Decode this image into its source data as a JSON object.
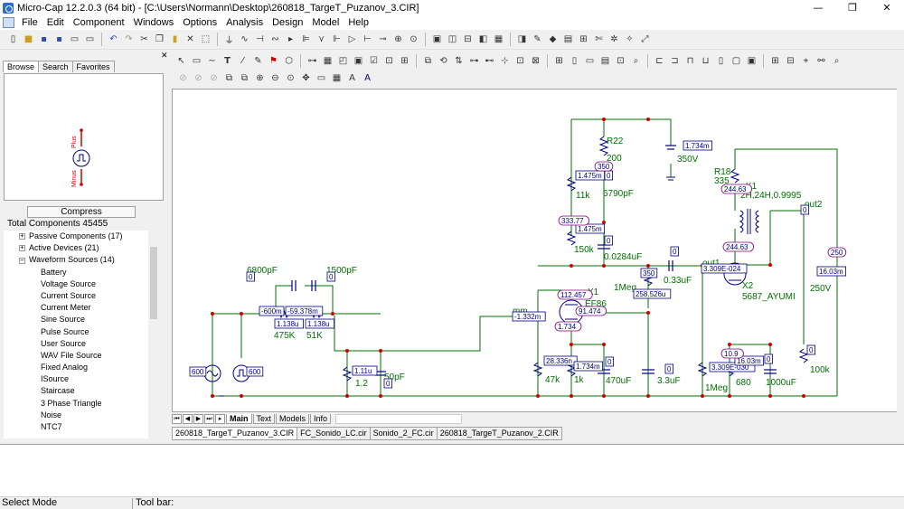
{
  "window": {
    "title": "Micro-Cap 12.2.0.3 (64 bit) - [C:\\Users\\Normann\\Desktop\\260818_TargeT_Puzanov_3.CIR]",
    "controls": [
      "—",
      "❐",
      "✕"
    ]
  },
  "menu": [
    "File",
    "Edit",
    "Component",
    "Windows",
    "Options",
    "Analysis",
    "Design",
    "Model",
    "Help"
  ],
  "left_panel": {
    "tabs": [
      "Browse",
      "Search",
      "Favorites"
    ],
    "active_tab": "Browse",
    "preview_labels": {
      "plus": "Plus",
      "minus": "Minus"
    },
    "compress_label": "Compress",
    "total_components": "Total Components 45455",
    "tree": [
      {
        "label": "Passive Components (17)",
        "expander": "+"
      },
      {
        "label": "Active Devices (21)",
        "expander": "+"
      },
      {
        "label": "Waveform Sources (14)",
        "expander": "−"
      },
      {
        "label": "Battery"
      },
      {
        "label": "Voltage Source"
      },
      {
        "label": "Current Source"
      },
      {
        "label": "Current Meter"
      },
      {
        "label": "Sine Source"
      },
      {
        "label": "Pulse Source"
      },
      {
        "label": "User Source"
      },
      {
        "label": "WAV File Source"
      },
      {
        "label": "Fixed Analog"
      },
      {
        "label": "ISource"
      },
      {
        "label": "Staircase"
      },
      {
        "label": "3 Phase Triangle"
      },
      {
        "label": "Noise"
      },
      {
        "label": "NTC7"
      }
    ]
  },
  "sheet_tabs": [
    "Main",
    "Text",
    "Models",
    "Info"
  ],
  "active_sheet": "Main",
  "file_tabs": [
    "260818_TargeT_Puzanov_3.CIR",
    "FC_Sonido_LC.cir",
    "Sonido_2_FC.cir",
    "260818_TargeT_Puzanov_2.CIR"
  ],
  "active_file": "260818_TargeT_Puzanov_3.CIR",
  "status": {
    "mode": "Select Mode",
    "toolbar": "Tool bar:"
  },
  "schematic": {
    "component_labels": {
      "r22": "R22",
      "r22_val": "200",
      "b350_val": "350V",
      "r18": "R18",
      "r18_val": "335",
      "k1": "K1",
      "k1_val": "2H,24H,0.9995",
      "out2": "out2",
      "pot11k": "11k",
      "c6790": "6790pF",
      "r150k": "150k",
      "c0284": "0.0284uF",
      "c033": "0.33uF",
      "out1": "out1",
      "x1": "X1",
      "ef86": "EF86",
      "r1meg_top": "1Meg",
      "x2": "X2",
      "ayumi": "5687_AYUMI",
      "v250": "250V",
      "c6800": "6800pF",
      "c1500": "1500pF",
      "r475k": "475K",
      "r51k": "51K",
      "mm": "mm",
      "c50p": "50pF",
      "r12": "1.2",
      "r47k": "47k",
      "r1k": "1k",
      "c470u": "470uF",
      "c33u": "3.3uF",
      "r1meg_bot": "1Meg",
      "r680": "680",
      "c1000u": "1000uF",
      "r100k": "100k"
    },
    "node_boxes": {
      "b1734m": "1.734m",
      "b1475m_a": "1.475m",
      "b0_10": "0",
      "b1475m_b": "1.475m",
      "b0_14a": "0",
      "b0_5": "0",
      "b350": "350",
      "b258": "258.526u",
      "b_out1": "3.309E-024",
      "b16_03": "16.03m",
      "b0_out2": "0",
      "b15": "0",
      "b16": "0",
      "b600m": "-600m",
      "b59378": "-59.378m",
      "b1138a": "1.138u",
      "b1138b": "1.138u",
      "b1332": "-1.332m",
      "b1734_x1": "1.734",
      "b600_a": "600",
      "b600_b": "600",
      "b111": "1.11u",
      "b0_17": "0",
      "b28336": "28.336n",
      "b1734m_b": "1.734m",
      "b0_12": "0",
      "b0_11": "0",
      "b3309_b": "3.309E-030",
      "b16_03b": "16.03m",
      "b0_13": "0",
      "b0_14b": "0"
    },
    "voltage_ovals": {
      "o350": "350",
      "o333": "333.77",
      "o24463a": "244.63",
      "o24463b": "244.63",
      "o250": "250",
      "o112": "112.457",
      "o91": "91.474",
      "o1734": "1.734",
      "o109": "10.9"
    },
    "colors": {
      "wire": "#007000",
      "component": "#000080",
      "node": "#cc0000",
      "oval": "#800080",
      "label": "#007000"
    }
  }
}
